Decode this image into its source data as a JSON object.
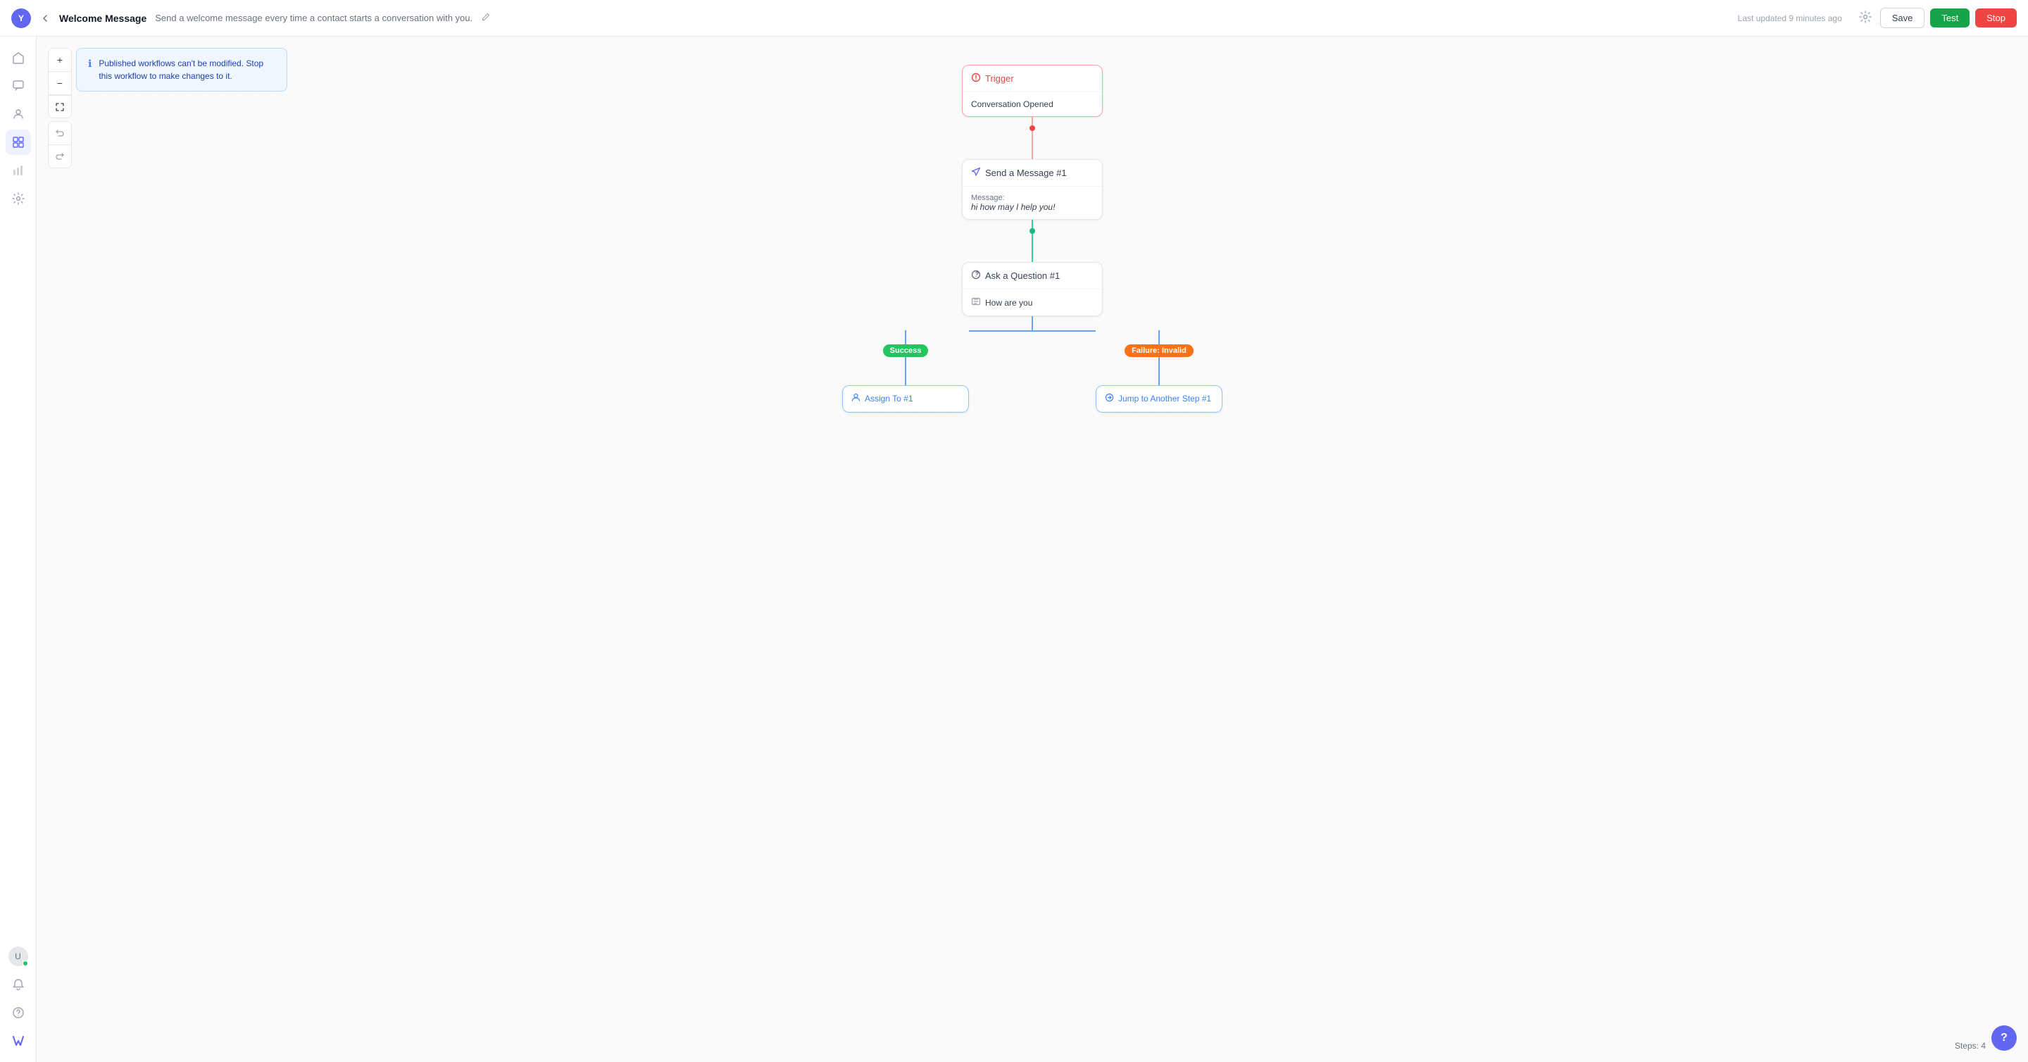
{
  "topbar": {
    "avatar_label": "Y",
    "back_label": "←",
    "title": "Welcome Message",
    "subtitle": "Send a welcome message every time a contact starts a conversation with you.",
    "edit_icon": "✏",
    "last_updated": "Last updated 9 minutes ago",
    "save_label": "Save",
    "test_label": "Test",
    "stop_label": "Stop"
  },
  "info_banner": {
    "text": "Published workflows can't be modified. Stop this workflow to make changes to it."
  },
  "sidebar": {
    "icons": [
      {
        "name": "home",
        "symbol": "⌂",
        "active": false
      },
      {
        "name": "chat",
        "symbol": "☰",
        "active": false
      },
      {
        "name": "contacts",
        "symbol": "👤",
        "active": false
      },
      {
        "name": "workflows",
        "symbol": "⊞",
        "active": true
      },
      {
        "name": "reports",
        "symbol": "📊",
        "active": false
      },
      {
        "name": "settings",
        "symbol": "⚙",
        "active": false
      }
    ],
    "bottom_icons": [
      {
        "name": "avatar-user",
        "symbol": "👤"
      },
      {
        "name": "notifications",
        "symbol": "🔔"
      },
      {
        "name": "help",
        "symbol": "?"
      },
      {
        "name": "logo",
        "symbol": "W"
      }
    ]
  },
  "workflow": {
    "trigger_node": {
      "header": "Trigger",
      "body": "Conversation Opened"
    },
    "send_message_node": {
      "header": "Send a Message #1",
      "message_label": "Message:",
      "message_body": "hi how may I help you!"
    },
    "ask_question_node": {
      "header": "Ask a Question #1",
      "body": "How are you"
    },
    "success_badge": "Success",
    "failure_badge": "Failure: Invalid",
    "assign_node": {
      "header": "Assign To #1"
    },
    "jump_node": {
      "header": "Jump to Another Step #1"
    }
  },
  "footer": {
    "steps_label": "Steps: 4",
    "help_label": "?"
  }
}
